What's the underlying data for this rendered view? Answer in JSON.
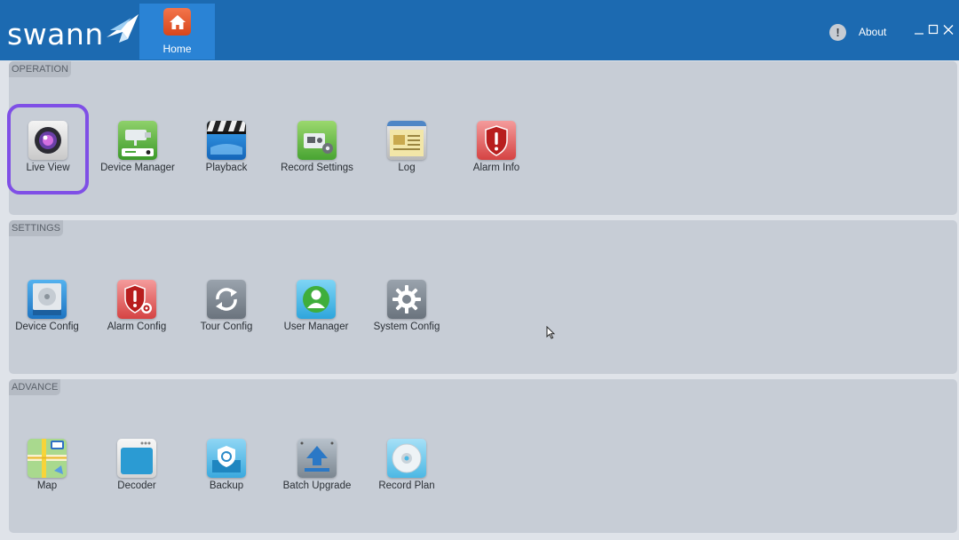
{
  "header": {
    "logo_text": "swann",
    "home_tab_label": "Home",
    "about_label": "About",
    "accent_color": "#1c6ab1",
    "selected_color": "#7f4fe6"
  },
  "sections": [
    {
      "title": "OPERATION",
      "items": [
        {
          "label": "Live View",
          "icon": "camera-lens-icon",
          "selected": true
        },
        {
          "label": "Device Manager",
          "icon": "camera-device-icon"
        },
        {
          "label": "Playback",
          "icon": "clapperboard-icon"
        },
        {
          "label": "Record Settings",
          "icon": "recorder-icon"
        },
        {
          "label": "Log",
          "icon": "log-book-icon"
        },
        {
          "label": "Alarm Info",
          "icon": "alarm-shield-icon"
        }
      ]
    },
    {
      "title": "SETTINGS",
      "items": [
        {
          "label": "Device Config",
          "icon": "hard-drive-icon"
        },
        {
          "label": "Alarm Config",
          "icon": "alarm-config-icon"
        },
        {
          "label": "Tour Config",
          "icon": "refresh-cycle-icon"
        },
        {
          "label": "User Manager",
          "icon": "user-icon"
        },
        {
          "label": "System Config",
          "icon": "gear-icon"
        }
      ]
    },
    {
      "title": "ADVANCE",
      "items": [
        {
          "label": "Map",
          "icon": "map-icon"
        },
        {
          "label": "Decoder",
          "icon": "decoder-icon"
        },
        {
          "label": "Backup",
          "icon": "backup-icon"
        },
        {
          "label": "Batch Upgrade",
          "icon": "upgrade-arrow-icon"
        },
        {
          "label": "Record Plan",
          "icon": "disc-icon"
        }
      ]
    }
  ]
}
